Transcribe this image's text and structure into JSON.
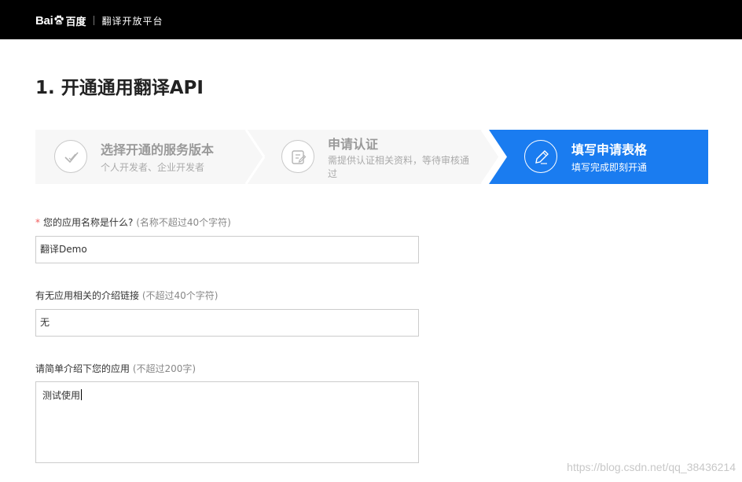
{
  "header": {
    "logo_text_bai": "Bai",
    "logo_text_du": "百度",
    "platform_name": "翻译开放平台"
  },
  "page_title": "1. 开通通用翻译API",
  "steps": [
    {
      "title": "选择开通的服务版本",
      "desc": "个人开发者、企业开发者",
      "icon": "check-icon",
      "state": "done"
    },
    {
      "title": "申请认证",
      "desc": "需提供认证相关资料，等待审核通过",
      "icon": "document-edit-icon",
      "state": "done"
    },
    {
      "title": "填写申请表格",
      "desc": "填写完成即刻开通",
      "icon": "pencil-icon",
      "state": "active"
    }
  ],
  "form": {
    "app_name": {
      "required_mark": "*",
      "label": "您的应用名称是什么?",
      "hint": "(名称不超过40个字符)",
      "value": "翻译Demo"
    },
    "intro_link": {
      "label": "有无应用相关的介绍链接",
      "hint": "(不超过40个字符)",
      "value": "无"
    },
    "intro_text": {
      "label": "请简单介绍下您的应用",
      "hint": "(不超过200字)",
      "value": "测试使用"
    }
  },
  "watermark": "https://blog.csdn.net/qq_38436214",
  "colors": {
    "header_bg": "#000000",
    "active_step": "#1a7cf0",
    "inactive_step": "#f7f7f7",
    "required": "#f15b5b"
  }
}
